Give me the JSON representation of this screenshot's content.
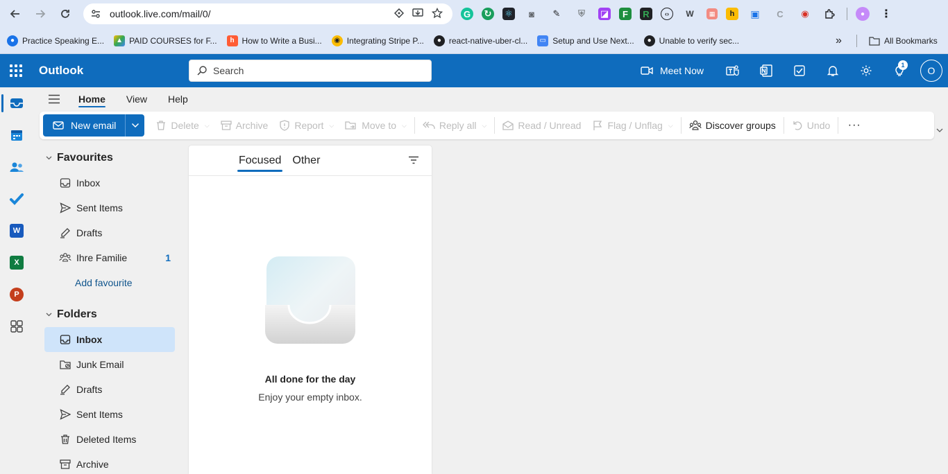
{
  "browser": {
    "url": "outlook.live.com/mail/0/",
    "bookmarks": [
      "Practice Speaking E...",
      "PAID COURSES for F...",
      "How to Write a Busi...",
      "Integrating Stripe P...",
      "react-native-uber-cl...",
      "Setup and Use Next...",
      "Unable to verify sec..."
    ],
    "all_bookmarks": "All Bookmarks",
    "more_bookmarks": "»"
  },
  "header": {
    "app_name": "Outlook",
    "search_placeholder": "Search",
    "meet_now": "Meet Now",
    "tips_badge": "1",
    "avatar_initial": "O"
  },
  "tabs": [
    "Home",
    "View",
    "Help"
  ],
  "toolbar": {
    "new_email": "New email",
    "delete": "Delete",
    "archive": "Archive",
    "report": "Report",
    "move_to": "Move to",
    "reply_all": "Reply all",
    "read_unread": "Read / Unread",
    "flag_unflag": "Flag / Unflag",
    "discover_groups": "Discover groups",
    "undo": "Undo",
    "more": "···"
  },
  "favourites": {
    "title": "Favourites",
    "items": [
      {
        "label": "Inbox"
      },
      {
        "label": "Sent Items"
      },
      {
        "label": "Drafts"
      },
      {
        "label": "Ihre Familie",
        "count": "1"
      }
    ],
    "add": "Add favourite"
  },
  "folders": {
    "title": "Folders",
    "items": [
      {
        "label": "Inbox"
      },
      {
        "label": "Junk Email"
      },
      {
        "label": "Drafts"
      },
      {
        "label": "Sent Items"
      },
      {
        "label": "Deleted Items"
      },
      {
        "label": "Archive"
      }
    ]
  },
  "message_list": {
    "pivot_focused": "Focused",
    "pivot_other": "Other",
    "empty_title": "All done for the day",
    "empty_subtitle": "Enjoy your empty inbox."
  },
  "colors": {
    "brand": "#0f6cbd",
    "selected_folder": "#cfe4fa"
  }
}
